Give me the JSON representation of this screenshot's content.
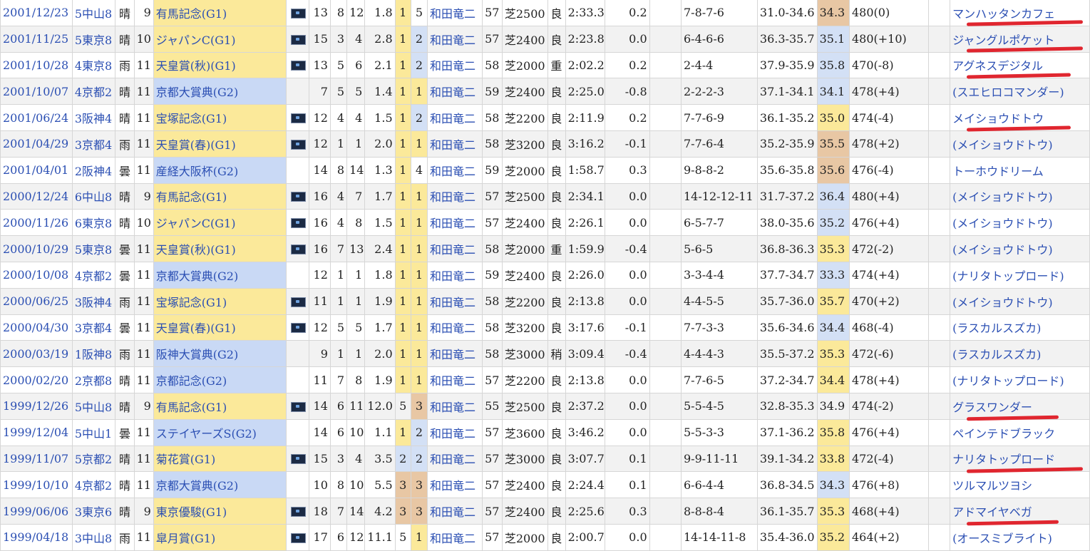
{
  "rows": [
    {
      "date": "2001/12/23",
      "venue": "5中山8",
      "weather": "晴",
      "r": "9",
      "race": "有馬記念(G1)",
      "grade": "G1",
      "video": true,
      "n": "13",
      "g": "8",
      "u": "12",
      "odds": "1.8",
      "pop": "1",
      "pop_c": "b1",
      "pl": "5",
      "pl_c": "",
      "jockey": "和田竜二",
      "wt": "57",
      "dist": "芝2500",
      "cond": "良",
      "time": "2:33.3",
      "diff": "0.2",
      "pass": "7-8-7-6",
      "pace": "31.0-34.6",
      "last": "34.3",
      "last_c": "b3",
      "bw": "480(0)",
      "winner": "マンハッタンカフェ",
      "ul": true
    },
    {
      "date": "2001/11/25",
      "venue": "5東京8",
      "weather": "晴",
      "r": "10",
      "race": "ジャパンC(G1)",
      "grade": "G1",
      "video": true,
      "n": "15",
      "g": "3",
      "u": "4",
      "odds": "2.8",
      "pop": "1",
      "pop_c": "b1",
      "pl": "2",
      "pl_c": "b2",
      "jockey": "和田竜二",
      "wt": "57",
      "dist": "芝2400",
      "cond": "良",
      "time": "2:23.8",
      "diff": "0.0",
      "pass": "6-4-6-6",
      "pace": "36.3-35.7",
      "last": "35.1",
      "last_c": "b2",
      "bw": "480(+10)",
      "winner": "ジャングルポケット",
      "ul": true
    },
    {
      "date": "2001/10/28",
      "venue": "4東京8",
      "weather": "雨",
      "r": "11",
      "race": "天皇賞(秋)(G1)",
      "grade": "G1",
      "video": true,
      "n": "13",
      "g": "5",
      "u": "6",
      "odds": "2.1",
      "pop": "1",
      "pop_c": "b1",
      "pl": "2",
      "pl_c": "b2",
      "jockey": "和田竜二",
      "wt": "58",
      "dist": "芝2000",
      "cond": "重",
      "time": "2:02.2",
      "diff": "0.2",
      "pass": "2-4-4",
      "pace": "37.9-35.9",
      "last": "35.8",
      "last_c": "b2",
      "bw": "470(-8)",
      "winner": "アグネスデジタル",
      "ul": true
    },
    {
      "date": "2001/10/07",
      "venue": "4京都2",
      "weather": "晴",
      "r": "11",
      "race": "京都大賞典(G2)",
      "grade": "G2",
      "video": false,
      "n": "7",
      "g": "5",
      "u": "5",
      "odds": "1.4",
      "pop": "1",
      "pop_c": "b1",
      "pl": "1",
      "pl_c": "b1",
      "jockey": "和田竜二",
      "wt": "59",
      "dist": "芝2400",
      "cond": "良",
      "time": "2:25.0",
      "diff": "-0.8",
      "pass": "2-2-2-3",
      "pace": "37.1-34.1",
      "last": "34.1",
      "last_c": "b2",
      "bw": "478(+4)",
      "winner": "(スエヒロコマンダー)",
      "ul": false
    },
    {
      "date": "2001/06/24",
      "venue": "3阪神4",
      "weather": "晴",
      "r": "11",
      "race": "宝塚記念(G1)",
      "grade": "G1",
      "video": true,
      "n": "12",
      "g": "4",
      "u": "4",
      "odds": "1.5",
      "pop": "1",
      "pop_c": "b1",
      "pl": "2",
      "pl_c": "b2",
      "jockey": "和田竜二",
      "wt": "58",
      "dist": "芝2200",
      "cond": "良",
      "time": "2:11.9",
      "diff": "0.2",
      "pass": "7-7-6-9",
      "pace": "36.1-35.2",
      "last": "35.0",
      "last_c": "b1",
      "bw": "474(-4)",
      "winner": "メイショウドトウ",
      "ul": true
    },
    {
      "date": "2001/04/29",
      "venue": "3京都4",
      "weather": "雨",
      "r": "11",
      "race": "天皇賞(春)(G1)",
      "grade": "G1",
      "video": true,
      "n": "12",
      "g": "1",
      "u": "1",
      "odds": "2.0",
      "pop": "1",
      "pop_c": "b1",
      "pl": "1",
      "pl_c": "b1",
      "jockey": "和田竜二",
      "wt": "58",
      "dist": "芝3200",
      "cond": "良",
      "time": "3:16.2",
      "diff": "-0.1",
      "pass": "7-7-6-4",
      "pace": "35.2-35.9",
      "last": "35.5",
      "last_c": "b3",
      "bw": "478(+2)",
      "winner": "(メイショウドトウ)",
      "ul": false
    },
    {
      "date": "2001/04/01",
      "venue": "2阪神4",
      "weather": "曇",
      "r": "11",
      "race": "産経大阪杯(G2)",
      "grade": "G2",
      "video": false,
      "n": "14",
      "g": "8",
      "u": "14",
      "odds": "1.3",
      "pop": "1",
      "pop_c": "b1",
      "pl": "4",
      "pl_c": "",
      "jockey": "和田竜二",
      "wt": "59",
      "dist": "芝2000",
      "cond": "良",
      "time": "1:58.7",
      "diff": "0.3",
      "pass": "9-8-8-2",
      "pace": "35.6-35.8",
      "last": "35.6",
      "last_c": "b3",
      "bw": "476(-4)",
      "winner": "トーホウドリーム",
      "ul": false
    },
    {
      "date": "2000/12/24",
      "venue": "6中山8",
      "weather": "晴",
      "r": "9",
      "race": "有馬記念(G1)",
      "grade": "G1",
      "video": true,
      "n": "16",
      "g": "4",
      "u": "7",
      "odds": "1.7",
      "pop": "1",
      "pop_c": "b1",
      "pl": "1",
      "pl_c": "b1",
      "jockey": "和田竜二",
      "wt": "57",
      "dist": "芝2500",
      "cond": "良",
      "time": "2:34.1",
      "diff": "0.0",
      "pass": "14-12-12-11",
      "pace": "31.7-37.2",
      "last": "36.4",
      "last_c": "b2",
      "bw": "480(+4)",
      "winner": "(メイショウドトウ)",
      "ul": false
    },
    {
      "date": "2000/11/26",
      "venue": "6東京8",
      "weather": "晴",
      "r": "10",
      "race": "ジャパンC(G1)",
      "grade": "G1",
      "video": true,
      "n": "16",
      "g": "4",
      "u": "8",
      "odds": "1.5",
      "pop": "1",
      "pop_c": "b1",
      "pl": "1",
      "pl_c": "b1",
      "jockey": "和田竜二",
      "wt": "57",
      "dist": "芝2400",
      "cond": "良",
      "time": "2:26.1",
      "diff": "0.0",
      "pass": "6-5-7-7",
      "pace": "38.0-35.6",
      "last": "35.2",
      "last_c": "b2",
      "bw": "476(+4)",
      "winner": "(メイショウドトウ)",
      "ul": false
    },
    {
      "date": "2000/10/29",
      "venue": "5東京8",
      "weather": "曇",
      "r": "11",
      "race": "天皇賞(秋)(G1)",
      "grade": "G1",
      "video": true,
      "n": "16",
      "g": "7",
      "u": "13",
      "odds": "2.4",
      "pop": "1",
      "pop_c": "b1",
      "pl": "1",
      "pl_c": "b1",
      "jockey": "和田竜二",
      "wt": "58",
      "dist": "芝2000",
      "cond": "重",
      "time": "1:59.9",
      "diff": "-0.4",
      "pass": "5-6-5",
      "pace": "36.8-36.3",
      "last": "35.3",
      "last_c": "b1",
      "bw": "472(-2)",
      "winner": "(メイショウドトウ)",
      "ul": false
    },
    {
      "date": "2000/10/08",
      "venue": "4京都2",
      "weather": "曇",
      "r": "11",
      "race": "京都大賞典(G2)",
      "grade": "G2",
      "video": false,
      "n": "12",
      "g": "1",
      "u": "1",
      "odds": "1.8",
      "pop": "1",
      "pop_c": "b1",
      "pl": "1",
      "pl_c": "b1",
      "jockey": "和田竜二",
      "wt": "59",
      "dist": "芝2400",
      "cond": "良",
      "time": "2:26.0",
      "diff": "0.0",
      "pass": "3-3-4-4",
      "pace": "37.7-34.7",
      "last": "33.3",
      "last_c": "b2",
      "bw": "474(+4)",
      "winner": "(ナリタトップロード)",
      "ul": false
    },
    {
      "date": "2000/06/25",
      "venue": "3阪神4",
      "weather": "雨",
      "r": "11",
      "race": "宝塚記念(G1)",
      "grade": "G1",
      "video": true,
      "n": "11",
      "g": "1",
      "u": "1",
      "odds": "1.9",
      "pop": "1",
      "pop_c": "b1",
      "pl": "1",
      "pl_c": "b1",
      "jockey": "和田竜二",
      "wt": "58",
      "dist": "芝2200",
      "cond": "良",
      "time": "2:13.8",
      "diff": "0.0",
      "pass": "4-4-5-5",
      "pace": "35.7-36.0",
      "last": "35.7",
      "last_c": "b1",
      "bw": "470(+2)",
      "winner": "(メイショウドトウ)",
      "ul": false
    },
    {
      "date": "2000/04/30",
      "venue": "3京都4",
      "weather": "曇",
      "r": "11",
      "race": "天皇賞(春)(G1)",
      "grade": "G1",
      "video": true,
      "n": "12",
      "g": "5",
      "u": "5",
      "odds": "1.7",
      "pop": "1",
      "pop_c": "b1",
      "pl": "1",
      "pl_c": "b1",
      "jockey": "和田竜二",
      "wt": "58",
      "dist": "芝3200",
      "cond": "良",
      "time": "3:17.6",
      "diff": "-0.1",
      "pass": "7-7-3-3",
      "pace": "35.6-34.6",
      "last": "34.4",
      "last_c": "b2",
      "bw": "468(-4)",
      "winner": "(ラスカルスズカ)",
      "ul": false
    },
    {
      "date": "2000/03/19",
      "venue": "1阪神8",
      "weather": "雨",
      "r": "11",
      "race": "阪神大賞典(G2)",
      "grade": "G2",
      "video": false,
      "n": "9",
      "g": "1",
      "u": "1",
      "odds": "2.0",
      "pop": "1",
      "pop_c": "b1",
      "pl": "1",
      "pl_c": "b1",
      "jockey": "和田竜二",
      "wt": "58",
      "dist": "芝3000",
      "cond": "稍",
      "time": "3:09.4",
      "diff": "-0.4",
      "pass": "4-4-4-3",
      "pace": "35.5-37.2",
      "last": "35.3",
      "last_c": "b1",
      "bw": "472(-6)",
      "winner": "(ラスカルスズカ)",
      "ul": false
    },
    {
      "date": "2000/02/20",
      "venue": "2京都8",
      "weather": "晴",
      "r": "11",
      "race": "京都記念(G2)",
      "grade": "G2",
      "video": false,
      "n": "11",
      "g": "7",
      "u": "8",
      "odds": "1.9",
      "pop": "1",
      "pop_c": "b1",
      "pl": "1",
      "pl_c": "b1",
      "jockey": "和田竜二",
      "wt": "57",
      "dist": "芝2200",
      "cond": "良",
      "time": "2:13.8",
      "diff": "0.0",
      "pass": "7-7-6-5",
      "pace": "37.2-34.7",
      "last": "34.4",
      "last_c": "b1",
      "bw": "478(+4)",
      "winner": "(ナリタトップロード)",
      "ul": false
    },
    {
      "date": "1999/12/26",
      "venue": "5中山8",
      "weather": "晴",
      "r": "9",
      "race": "有馬記念(G1)",
      "grade": "G1",
      "video": true,
      "n": "14",
      "g": "6",
      "u": "11",
      "odds": "12.0",
      "pop": "5",
      "pop_c": "",
      "pl": "3",
      "pl_c": "b3",
      "jockey": "和田竜二",
      "wt": "55",
      "dist": "芝2500",
      "cond": "良",
      "time": "2:37.2",
      "diff": "0.0",
      "pass": "5-5-4-5",
      "pace": "32.8-35.3",
      "last": "34.9",
      "last_c": "",
      "bw": "474(-2)",
      "winner": "グラスワンダー",
      "ul": true
    },
    {
      "date": "1999/12/04",
      "venue": "5中山1",
      "weather": "曇",
      "r": "11",
      "race": "ステイヤーズS(G2)",
      "grade": "G2",
      "video": false,
      "n": "14",
      "g": "6",
      "u": "10",
      "odds": "1.1",
      "pop": "1",
      "pop_c": "b1",
      "pl": "2",
      "pl_c": "b2",
      "jockey": "和田竜二",
      "wt": "57",
      "dist": "芝3600",
      "cond": "良",
      "time": "3:46.2",
      "diff": "0.0",
      "pass": "5-5-3-3",
      "pace": "37.1-36.2",
      "last": "35.8",
      "last_c": "b1",
      "bw": "476(+4)",
      "winner": "ペインテドブラック",
      "ul": false
    },
    {
      "date": "1999/11/07",
      "venue": "5京都2",
      "weather": "晴",
      "r": "11",
      "race": "菊花賞(G1)",
      "grade": "G1",
      "video": true,
      "n": "15",
      "g": "3",
      "u": "4",
      "odds": "3.5",
      "pop": "2",
      "pop_c": "b2",
      "pl": "2",
      "pl_c": "b2",
      "jockey": "和田竜二",
      "wt": "57",
      "dist": "芝3000",
      "cond": "良",
      "time": "3:07.7",
      "diff": "0.1",
      "pass": "9-9-11-11",
      "pace": "39.1-34.2",
      "last": "33.8",
      "last_c": "b1",
      "bw": "472(-4)",
      "winner": "ナリタトップロード",
      "ul": true
    },
    {
      "date": "1999/10/10",
      "venue": "4京都2",
      "weather": "晴",
      "r": "11",
      "race": "京都大賞典(G2)",
      "grade": "G2",
      "video": false,
      "n": "10",
      "g": "8",
      "u": "10",
      "odds": "5.5",
      "pop": "3",
      "pop_c": "b3",
      "pl": "3",
      "pl_c": "b3",
      "jockey": "和田竜二",
      "wt": "57",
      "dist": "芝2400",
      "cond": "良",
      "time": "2:24.4",
      "diff": "0.1",
      "pass": "6-6-4-4",
      "pace": "36.8-34.5",
      "last": "34.3",
      "last_c": "b2",
      "bw": "476(+8)",
      "winner": "ツルマルツヨシ",
      "ul": false
    },
    {
      "date": "1999/06/06",
      "venue": "3東京6",
      "weather": "晴",
      "r": "9",
      "race": "東京優駿(G1)",
      "grade": "G1",
      "video": true,
      "n": "18",
      "g": "7",
      "u": "14",
      "odds": "4.2",
      "pop": "3",
      "pop_c": "b3",
      "pl": "3",
      "pl_c": "b3",
      "jockey": "和田竜二",
      "wt": "57",
      "dist": "芝2400",
      "cond": "良",
      "time": "2:25.6",
      "diff": "0.3",
      "pass": "8-8-8-4",
      "pace": "36.1-35.7",
      "last": "35.3",
      "last_c": "b1",
      "bw": "468(+4)",
      "winner": "アドマイヤベガ",
      "ul": true
    },
    {
      "date": "1999/04/18",
      "venue": "3中山8",
      "weather": "雨",
      "r": "11",
      "race": "皐月賞(G1)",
      "grade": "G1",
      "video": true,
      "n": "17",
      "g": "6",
      "u": "12",
      "odds": "11.1",
      "pop": "5",
      "pop_c": "",
      "pl": "1",
      "pl_c": "b1",
      "jockey": "和田竜二",
      "wt": "57",
      "dist": "芝2000",
      "cond": "良",
      "time": "2:00.7",
      "diff": "0.0",
      "pass": "14-14-11-8",
      "pace": "35.4-36.0",
      "last": "35.2",
      "last_c": "b1",
      "bw": "464(+2)",
      "winner": "(オースミブライト)",
      "ul": false
    }
  ]
}
